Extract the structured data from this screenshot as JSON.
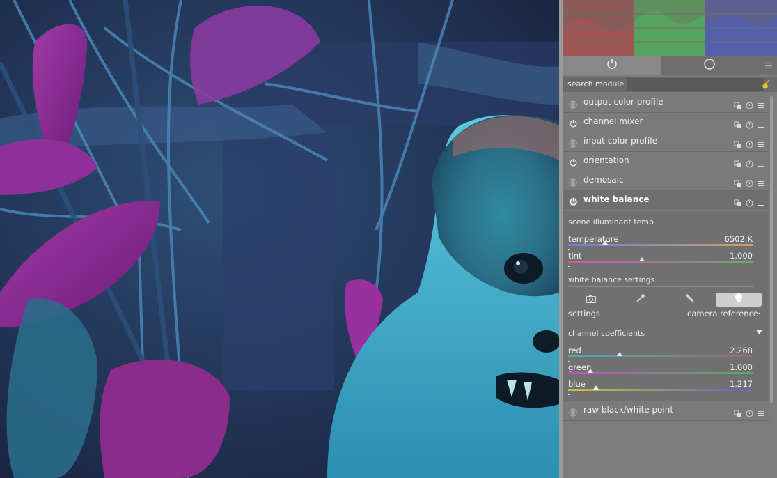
{
  "app": {
    "tabs": [
      {
        "name": "active-modules",
        "icon": "power-icon"
      },
      {
        "name": "all-modules",
        "icon": "circle-icon"
      }
    ],
    "menu_icon": "hamburger-icon"
  },
  "search": {
    "label": "search module",
    "value": "",
    "placeholder": "",
    "clear_icon": "broom-icon"
  },
  "modules": [
    {
      "label": "output color profile",
      "indicator": "circle-icon",
      "enabled": false
    },
    {
      "label": "channel mixer",
      "indicator": "power-icon",
      "enabled": true
    },
    {
      "label": "input color profile",
      "indicator": "circle-icon",
      "enabled": false
    },
    {
      "label": "orientation",
      "indicator": "power-icon",
      "enabled": true
    },
    {
      "label": "demosaic",
      "indicator": "circle-icon",
      "enabled": false
    },
    {
      "label": "white balance",
      "indicator": "power-icon",
      "enabled": true,
      "expanded": true
    }
  ],
  "after_modules": [
    {
      "label": "raw black/white point",
      "indicator": "circle-icon",
      "enabled": false
    }
  ],
  "module_action_icons": [
    "presets-icon",
    "reset-icon",
    "menu-icon"
  ],
  "white_balance": {
    "scene_section": "scene illuminant temp",
    "temperature": {
      "label": "temperature",
      "value": "6502 K",
      "position": 0.2
    },
    "tint": {
      "label": "tint",
      "value": "1.000",
      "position": 0.4
    },
    "settings_section": "white balance settings",
    "setting_buttons": [
      {
        "name": "camera-icon",
        "active": false
      },
      {
        "name": "eyedropper-icon",
        "active": false
      },
      {
        "name": "pencil-icon",
        "active": false
      },
      {
        "name": "bulb-icon",
        "active": true
      }
    ],
    "settings_label": "settings",
    "settings_value": "camera reference",
    "coefficients_section": "channel coefficients",
    "red": {
      "label": "red",
      "value": "2.268",
      "position": 0.28
    },
    "green": {
      "label": "green",
      "value": "1.000",
      "position": 0.12
    },
    "blue": {
      "label": "blue",
      "value": "1.217",
      "position": 0.15
    }
  },
  "colors": {
    "panel_bg": "#7c7c7c",
    "hist_red": "#b05050",
    "hist_green": "#50b060",
    "hist_blue": "#5060c0",
    "photo_cyan": "#3aa8c8",
    "photo_magenta": "#a028a8"
  }
}
